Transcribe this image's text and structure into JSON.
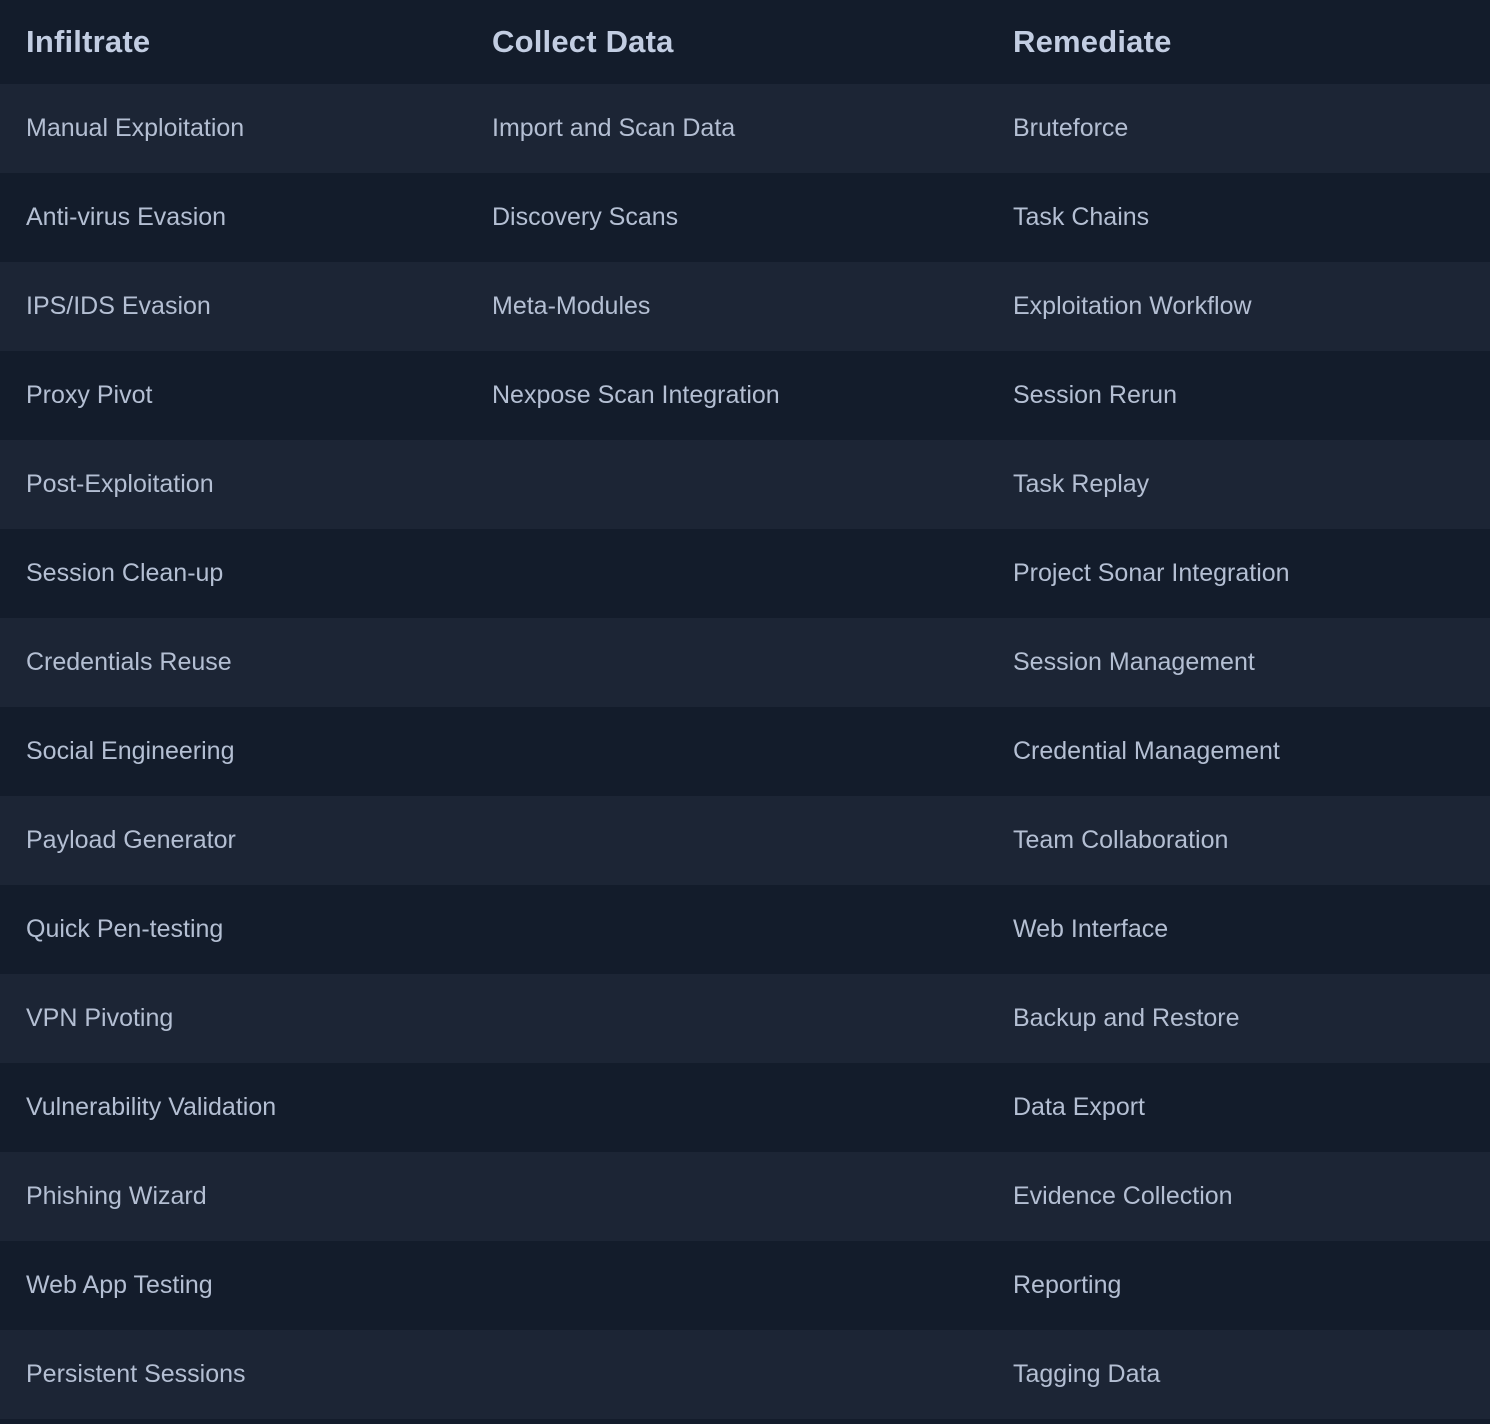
{
  "columns": [
    "Infiltrate",
    "Collect Data",
    "Remediate"
  ],
  "rows": [
    [
      "Manual Exploitation",
      "Import and Scan Data",
      "Bruteforce"
    ],
    [
      "Anti-virus Evasion",
      "Discovery Scans",
      "Task Chains"
    ],
    [
      "IPS/IDS Evasion",
      "Meta-Modules",
      "Exploitation Workflow"
    ],
    [
      "Proxy Pivot",
      "Nexpose Scan Integration",
      "Session Rerun"
    ],
    [
      "Post-Exploitation",
      "",
      "Task Replay"
    ],
    [
      "Session Clean-up",
      "",
      "Project Sonar Integration"
    ],
    [
      "Credentials Reuse",
      "",
      "Session Management"
    ],
    [
      "Social Engineering",
      "",
      "Credential Management"
    ],
    [
      "Payload Generator",
      "",
      "Team Collaboration"
    ],
    [
      "Quick Pen-testing",
      "",
      "Web Interface"
    ],
    [
      "VPN Pivoting",
      "",
      "Backup and Restore"
    ],
    [
      "Vulnerability Validation",
      "",
      "Data Export"
    ],
    [
      "Phishing Wizard",
      "",
      "Evidence Collection"
    ],
    [
      "Web App Testing",
      "",
      "Reporting"
    ],
    [
      "Persistent Sessions",
      "",
      "Tagging Data"
    ]
  ],
  "colors": {
    "background": "#131c2b",
    "row_alt": "#1c2535",
    "header_text": "#c2cde2",
    "cell_text": "#b4bfd3"
  }
}
